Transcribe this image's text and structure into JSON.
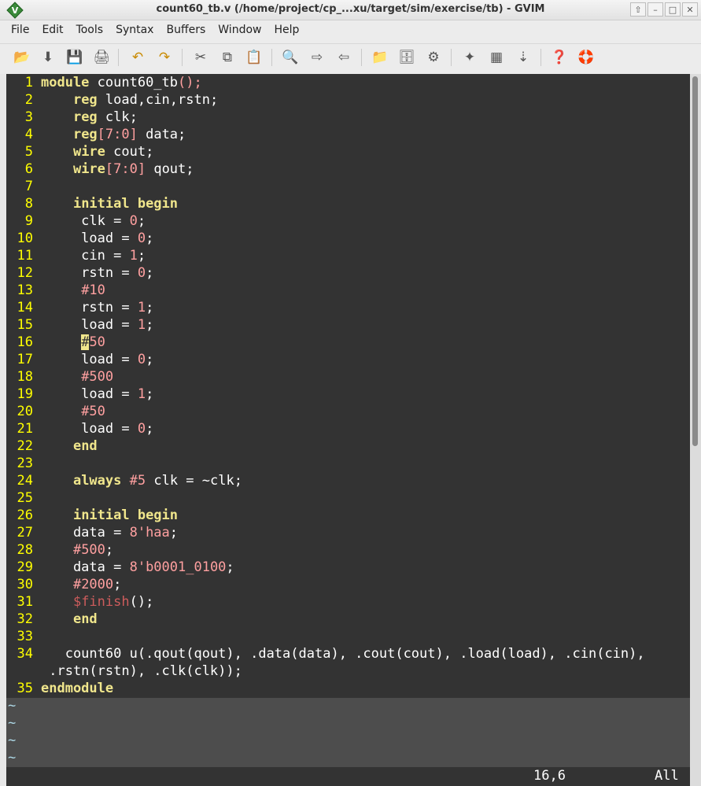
{
  "window": {
    "title": "count60_tb.v (/home/project/cp_...xu/target/sim/exercise/tb) - GVIM",
    "buttons": [
      "⇧",
      "–",
      "□",
      "✕"
    ]
  },
  "menu": [
    "File",
    "Edit",
    "Tools",
    "Syntax",
    "Buffers",
    "Window",
    "Help"
  ],
  "toolbar": [
    {
      "icon": "open-icon",
      "glyph": "📂"
    },
    {
      "icon": "save-download-icon",
      "glyph": "⬇"
    },
    {
      "icon": "save-icon",
      "glyph": "💾"
    },
    {
      "icon": "print-icon",
      "glyph": "🖨"
    },
    {
      "icon": "undo-icon",
      "glyph": "↶"
    },
    {
      "icon": "redo-icon",
      "glyph": "↷"
    },
    {
      "icon": "cut-icon",
      "glyph": "✂"
    },
    {
      "icon": "copy-icon",
      "glyph": "⧉"
    },
    {
      "icon": "paste-icon",
      "glyph": "📋"
    },
    {
      "icon": "find-replace-icon",
      "glyph": "🔍"
    },
    {
      "icon": "find-next-icon",
      "glyph": "⇨"
    },
    {
      "icon": "find-prev-icon",
      "glyph": "⇦"
    },
    {
      "icon": "load-session-icon",
      "glyph": "📁"
    },
    {
      "icon": "save-session-icon",
      "glyph": "🗄"
    },
    {
      "icon": "run-script-icon",
      "glyph": "⚙"
    },
    {
      "icon": "make-icon",
      "glyph": "✦"
    },
    {
      "icon": "shell-icon",
      "glyph": "▦"
    },
    {
      "icon": "tags-icon",
      "glyph": "⇣"
    },
    {
      "icon": "help-icon",
      "glyph": "❓"
    },
    {
      "icon": "lifebuoy-icon",
      "glyph": "🛟"
    }
  ],
  "code_lines": [
    {
      "n": "1",
      "segs": [
        [
          "kw",
          "module"
        ],
        [
          "",
          " count60_tb"
        ],
        [
          "num",
          "();"
        ]
      ]
    },
    {
      "n": "2",
      "segs": [
        [
          "",
          "    "
        ],
        [
          "kw",
          "reg"
        ],
        [
          "",
          " load,cin,rstn;"
        ]
      ]
    },
    {
      "n": "3",
      "segs": [
        [
          "",
          "    "
        ],
        [
          "kw",
          "reg"
        ],
        [
          "",
          " clk;"
        ]
      ]
    },
    {
      "n": "4",
      "segs": [
        [
          "",
          "    "
        ],
        [
          "kw",
          "reg"
        ],
        [
          "num",
          "[7:0]"
        ],
        [
          "",
          " data;"
        ]
      ]
    },
    {
      "n": "5",
      "segs": [
        [
          "",
          "    "
        ],
        [
          "kw",
          "wire"
        ],
        [
          "",
          " cout;"
        ]
      ]
    },
    {
      "n": "6",
      "segs": [
        [
          "",
          "    "
        ],
        [
          "kw",
          "wire"
        ],
        [
          "num",
          "[7:0]"
        ],
        [
          "",
          " qout;"
        ]
      ]
    },
    {
      "n": "7",
      "segs": []
    },
    {
      "n": "8",
      "segs": [
        [
          "",
          "    "
        ],
        [
          "kw",
          "initial begin"
        ]
      ]
    },
    {
      "n": "9",
      "segs": [
        [
          "",
          "     clk = "
        ],
        [
          "num",
          "0"
        ],
        [
          "",
          ";"
        ]
      ]
    },
    {
      "n": "10",
      "segs": [
        [
          "",
          "     load = "
        ],
        [
          "num",
          "0"
        ],
        [
          "",
          ";"
        ]
      ]
    },
    {
      "n": "11",
      "segs": [
        [
          "",
          "     cin = "
        ],
        [
          "num",
          "1"
        ],
        [
          "",
          ";"
        ]
      ]
    },
    {
      "n": "12",
      "segs": [
        [
          "",
          "     rstn = "
        ],
        [
          "num",
          "0"
        ],
        [
          "",
          ";"
        ]
      ]
    },
    {
      "n": "13",
      "segs": [
        [
          "",
          "     "
        ],
        [
          "num",
          "#10"
        ]
      ]
    },
    {
      "n": "14",
      "segs": [
        [
          "",
          "     rstn = "
        ],
        [
          "num",
          "1"
        ],
        [
          "",
          ";"
        ]
      ]
    },
    {
      "n": "15",
      "segs": [
        [
          "",
          "     load = "
        ],
        [
          "num",
          "1"
        ],
        [
          "",
          ";"
        ]
      ]
    },
    {
      "n": "16",
      "segs": [
        [
          "",
          "     "
        ],
        [
          "cursor",
          "#"
        ],
        [
          "num",
          "50"
        ]
      ]
    },
    {
      "n": "17",
      "segs": [
        [
          "",
          "     load = "
        ],
        [
          "num",
          "0"
        ],
        [
          "",
          ";"
        ]
      ]
    },
    {
      "n": "18",
      "segs": [
        [
          "",
          "     "
        ],
        [
          "num",
          "#500"
        ]
      ]
    },
    {
      "n": "19",
      "segs": [
        [
          "",
          "     load = "
        ],
        [
          "num",
          "1"
        ],
        [
          "",
          ";"
        ]
      ]
    },
    {
      "n": "20",
      "segs": [
        [
          "",
          "     "
        ],
        [
          "num",
          "#50"
        ]
      ]
    },
    {
      "n": "21",
      "segs": [
        [
          "",
          "     load = "
        ],
        [
          "num",
          "0"
        ],
        [
          "",
          ";"
        ]
      ]
    },
    {
      "n": "22",
      "segs": [
        [
          "",
          "    "
        ],
        [
          "kw",
          "end"
        ]
      ]
    },
    {
      "n": "23",
      "segs": []
    },
    {
      "n": "24",
      "segs": [
        [
          "",
          "    "
        ],
        [
          "kw",
          "always"
        ],
        [
          "",
          " "
        ],
        [
          "num",
          "#5"
        ],
        [
          "",
          " clk = ~clk;"
        ]
      ]
    },
    {
      "n": "25",
      "segs": []
    },
    {
      "n": "26",
      "segs": [
        [
          "",
          "    "
        ],
        [
          "kw",
          "initial begin"
        ]
      ]
    },
    {
      "n": "27",
      "segs": [
        [
          "",
          "    data = "
        ],
        [
          "num",
          "8'haa"
        ],
        [
          "",
          ";"
        ]
      ]
    },
    {
      "n": "28",
      "segs": [
        [
          "",
          "    "
        ],
        [
          "num",
          "#500"
        ],
        [
          "",
          ";"
        ]
      ]
    },
    {
      "n": "29",
      "segs": [
        [
          "",
          "    data = "
        ],
        [
          "num",
          "8'b0001_0100"
        ],
        [
          "",
          ";"
        ]
      ]
    },
    {
      "n": "30",
      "segs": [
        [
          "",
          "    "
        ],
        [
          "num",
          "#2000"
        ],
        [
          "",
          ";"
        ]
      ]
    },
    {
      "n": "31",
      "segs": [
        [
          "",
          "    "
        ],
        [
          "sys",
          "$finish"
        ],
        [
          "",
          "();"
        ]
      ]
    },
    {
      "n": "32",
      "segs": [
        [
          "",
          "    "
        ],
        [
          "kw",
          "end"
        ]
      ]
    },
    {
      "n": "33",
      "segs": []
    },
    {
      "n": "34",
      "segs": [
        [
          "",
          "   count60 u(.qout(qout), .data(data), .cout(cout), .load(load), .cin(cin),"
        ]
      ]
    },
    {
      "n": "",
      "segs": [
        [
          "",
          " .rstn(rstn), .clk(clk));"
        ]
      ]
    },
    {
      "n": "35",
      "segs": [
        [
          "kw",
          "endmodule"
        ]
      ]
    }
  ],
  "tildes": [
    "~",
    "~",
    "~",
    "~"
  ],
  "status": {
    "position": "16,6",
    "scroll": "All"
  }
}
